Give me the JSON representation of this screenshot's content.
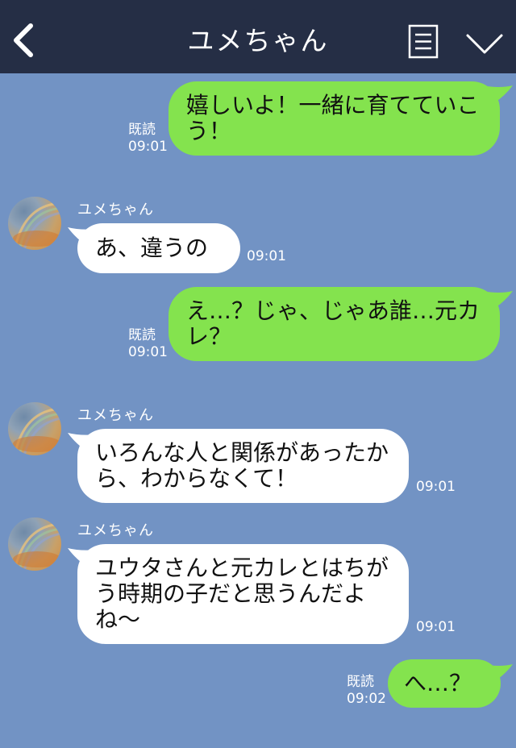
{
  "header": {
    "title": "ユメちゃん"
  },
  "read_label": "既読",
  "messages": [
    {
      "type": "sent",
      "text_lines": [
        "嬉しいよ！一緒に育てていこう！"
      ],
      "time": "09:01"
    },
    {
      "type": "received",
      "sender": "ユメちゃん",
      "text_lines": [
        "あ、違うの"
      ],
      "time": "09:01"
    },
    {
      "type": "sent",
      "text_lines": [
        "え…？じゃ、じゃあ誰…元カレ？"
      ],
      "time": "09:01"
    },
    {
      "type": "received",
      "sender": "ユメちゃん",
      "text_lines": [
        "いろんな人と関係があったから、わからなくて！"
      ],
      "time": "09:01"
    },
    {
      "type": "received",
      "sender": "ユメちゃん",
      "text_lines": [
        "ユウタさんと元カレとはちがう時期の子だと思うんだよね〜"
      ],
      "time": "09:01"
    },
    {
      "type": "sent",
      "text_lines": [
        "へ…？"
      ],
      "time": "09:02"
    }
  ]
}
